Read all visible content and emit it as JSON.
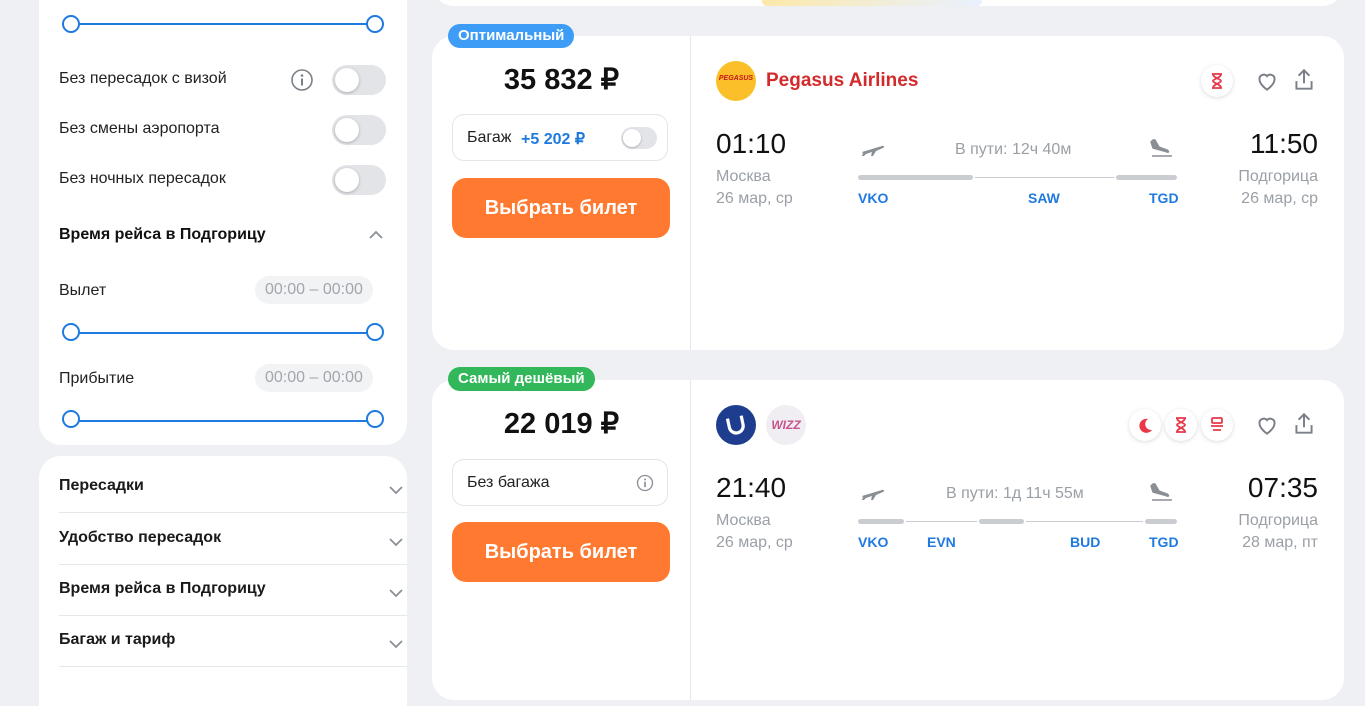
{
  "filters": {
    "toggles": [
      {
        "label": "Без пересадок с визой",
        "on": false
      },
      {
        "label": "Без смены аэропорта",
        "on": false
      },
      {
        "label": "Без ночных пересадок",
        "on": false
      }
    ],
    "flight_time_title": "Время рейса в Подгорицу",
    "departure": {
      "label": "Вылет",
      "range": "00:00 – 00:00"
    },
    "arrival": {
      "label": "Прибытие",
      "range": "00:00 – 00:00"
    }
  },
  "accordion": [
    {
      "label": "Пересадки"
    },
    {
      "label": "Удобство пересадок"
    },
    {
      "label": "Время рейса в Подгорицу"
    },
    {
      "label": "Багаж и тариф"
    }
  ],
  "tickets": [
    {
      "badge": "Оптимальный",
      "badge_color": "#3d9cf5",
      "price": "35 832 ₽",
      "baggage_label": "Багаж",
      "baggage_price": "+5 202 ₽",
      "select_label": "Выбрать билет",
      "airline": "Pegasus Airlines",
      "airline_logo_text": "PEGASUS",
      "dep_time": "01:10",
      "dep_city": "Москва",
      "dep_date": "26 мар, ср",
      "duration": "В пути: 12ч 40м",
      "arr_time": "11:50",
      "arr_city": "Подгорица",
      "arr_date": "26 мар, ср",
      "codes": [
        "VKO",
        "SAW",
        "TGD"
      ]
    },
    {
      "badge": "Самый дешёвый",
      "badge_color": "#32b85a",
      "price": "22 019 ₽",
      "baggage_label": "Без багажа",
      "select_label": "Выбрать билет",
      "airline_logo_text": "WIZZ",
      "dep_time": "21:40",
      "dep_city": "Москва",
      "dep_date": "26 мар, ср",
      "duration": "В пути: 1д 11ч 55м",
      "arr_time": "07:35",
      "arr_city": "Подгорица",
      "arr_date": "28 мар, пт",
      "codes": [
        "VKO",
        "EVN",
        "BUD",
        "TGD"
      ]
    }
  ]
}
